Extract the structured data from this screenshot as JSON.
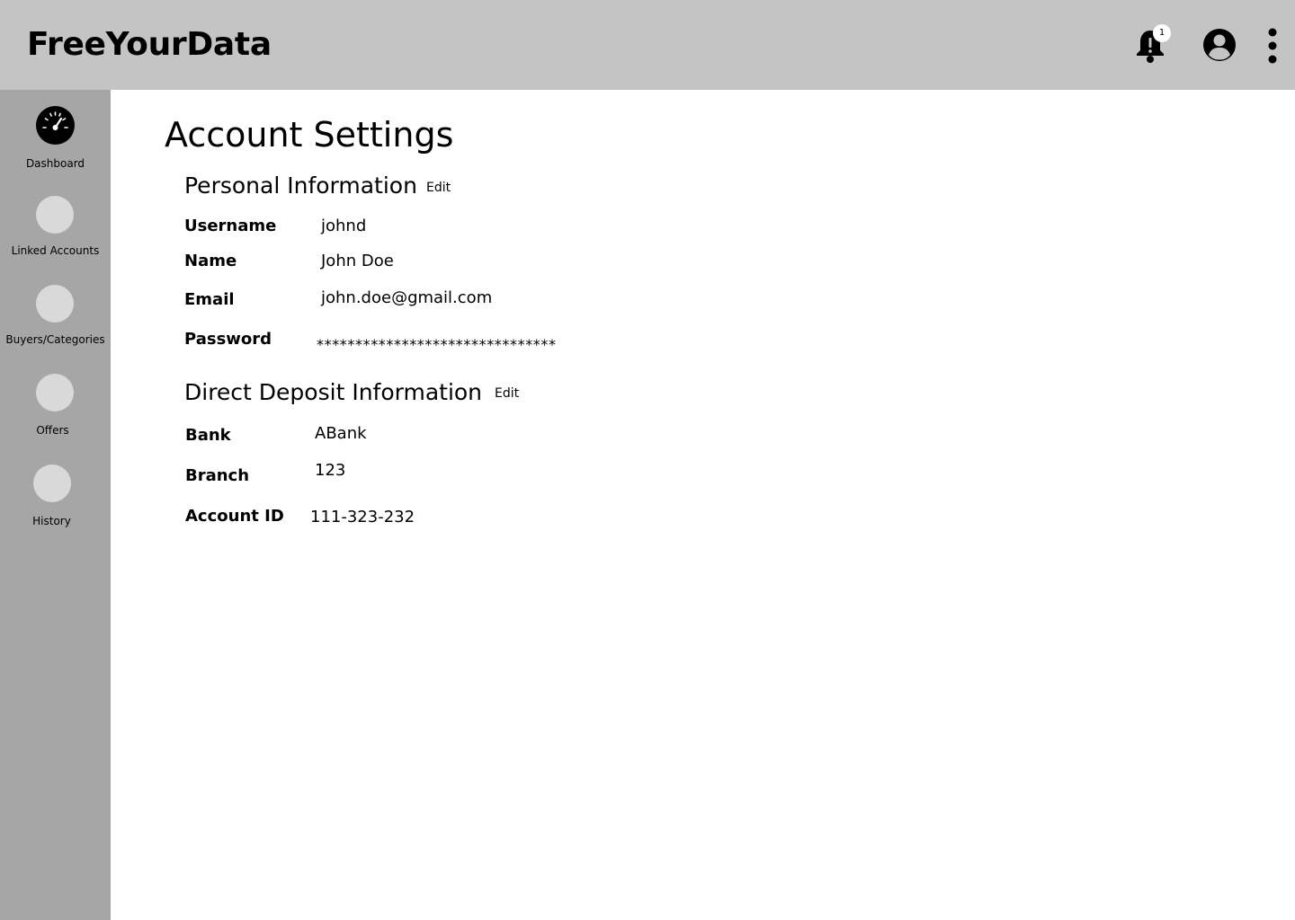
{
  "app": {
    "title": "FreeYourData"
  },
  "header": {
    "notifications": {
      "icon": "bell-alert-icon",
      "count": "1"
    },
    "account_icon": "account-circle-icon",
    "menu_icon": "kebab-menu-icon"
  },
  "sidebar": {
    "items": [
      {
        "label": "Dashboard",
        "icon": "speedometer-icon",
        "active": true
      },
      {
        "label": "Linked Accounts",
        "icon": "placeholder-circle-icon"
      },
      {
        "label": "Buyers/Categories",
        "icon": "placeholder-circle-icon"
      },
      {
        "label": "Offers",
        "icon": "placeholder-circle-icon"
      },
      {
        "label": "History",
        "icon": "placeholder-circle-icon"
      }
    ]
  },
  "page": {
    "title": "Account Settings"
  },
  "personal": {
    "title": "Personal Information",
    "edit_label": "Edit",
    "fields": [
      {
        "label": "Username",
        "value": "johnd"
      },
      {
        "label": "Name",
        "value": "John Doe"
      },
      {
        "label": "Email",
        "value": "john.doe@gmail.com"
      },
      {
        "label": "Password",
        "value": "*******************************"
      }
    ]
  },
  "deposit": {
    "title": "Direct Deposit Information",
    "edit_label": "Edit",
    "fields": [
      {
        "label": "Bank",
        "value": "ABank"
      },
      {
        "label": "Branch",
        "value": "123"
      },
      {
        "label": "Account ID",
        "value": "111-323-232"
      }
    ]
  },
  "colors": {
    "header_bg": "#c4c4c4",
    "sidebar_bg": "#a6a6a6",
    "placeholder_icon": "#d9d9d9",
    "content_bg": "#ffffff",
    "icon": "#000000"
  }
}
